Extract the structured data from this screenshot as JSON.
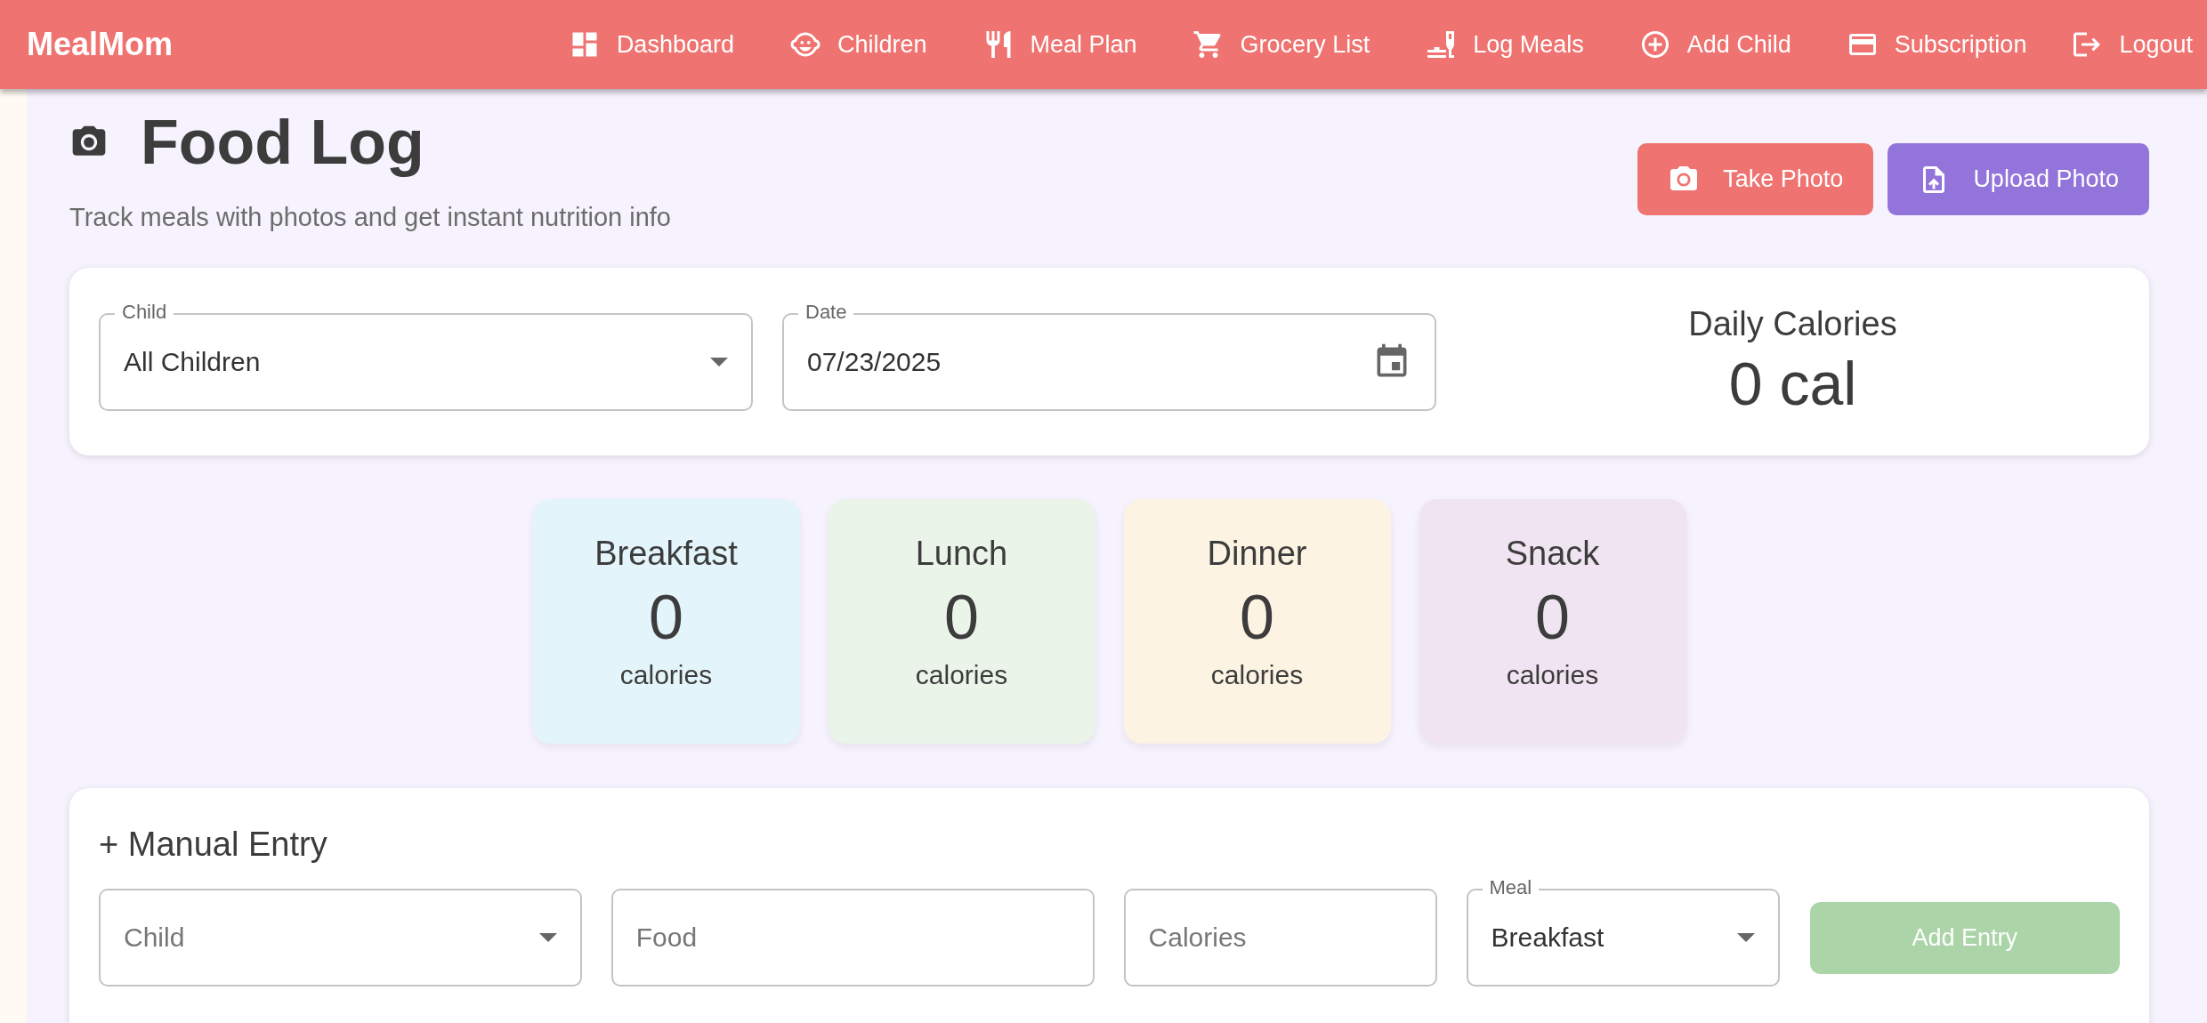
{
  "brand": "MealMom",
  "nav": [
    {
      "label": "Dashboard"
    },
    {
      "label": "Children"
    },
    {
      "label": "Meal Plan"
    },
    {
      "label": "Grocery List"
    },
    {
      "label": "Log Meals"
    },
    {
      "label": "Add Child"
    },
    {
      "label": "Subscription"
    },
    {
      "label": "Logout"
    }
  ],
  "header": {
    "title": "Food Log",
    "subtitle": "Track meals with photos and get instant nutrition info",
    "buttons": [
      {
        "label": "Take Photo",
        "color": "#ef7370"
      },
      {
        "label": "Upload Photo",
        "color": "#9274db"
      }
    ]
  },
  "filters": {
    "child": {
      "label": "Child",
      "value": "All Children"
    },
    "date": {
      "label": "Date",
      "value": "07/23/2025"
    },
    "daily": {
      "label": "Daily Calories",
      "value": "0 cal"
    }
  },
  "meals": [
    {
      "name": "Breakfast",
      "value": "0",
      "unit": "calories",
      "color": "#e3f5fa"
    },
    {
      "name": "Lunch",
      "value": "0",
      "unit": "calories",
      "color": "#eaf4e9"
    },
    {
      "name": "Dinner",
      "value": "0",
      "unit": "calories",
      "color": "#fdf3e2"
    },
    {
      "name": "Snack",
      "value": "0",
      "unit": "calories",
      "color": "#f1e4f2"
    }
  ],
  "manual": {
    "title": "+ Manual Entry",
    "child": {
      "placeholder": "Child"
    },
    "food": {
      "placeholder": "Food"
    },
    "calories": {
      "placeholder": "Calories"
    },
    "meal": {
      "label": "Meal",
      "value": "Breakfast"
    },
    "button": {
      "label": "Add Entry",
      "disabled": true
    }
  }
}
